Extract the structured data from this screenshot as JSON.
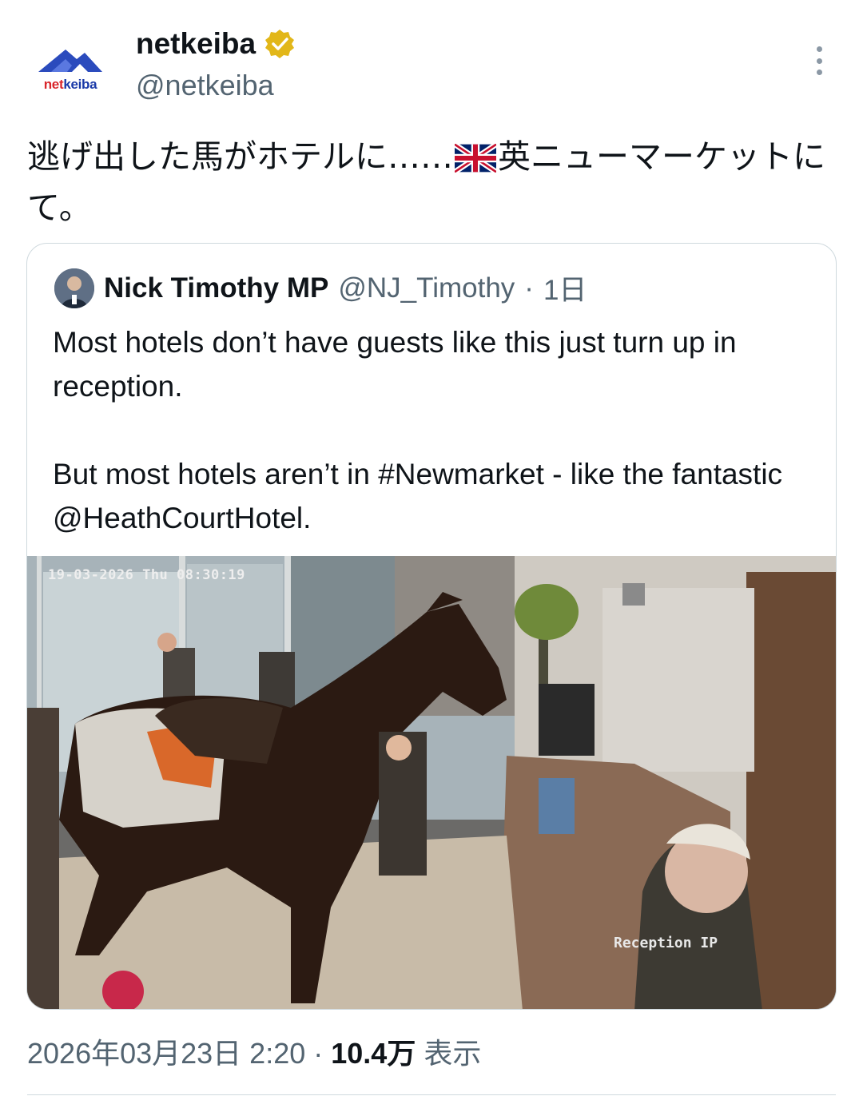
{
  "post": {
    "author": {
      "display_name": "netkeiba",
      "handle": "@netkeiba",
      "verified": true,
      "verified_color": "#e2b719",
      "avatar_logo_text": "netkeiba"
    },
    "more_icon": "more-vertical-icon",
    "text": "逃げ出した馬がホテルに……",
    "text_flag": "🇬🇧",
    "text_after_flag": "英ニューマーケットにて。",
    "quoted": {
      "display_name": "Nick Timothy MP",
      "handle": "@NJ_Timothy",
      "separator": "·",
      "time": "1日",
      "paragraph1": "Most hotels don’t have guests like this just turn up in reception.",
      "paragraph2": "But most hotels aren’t in #Newmarket - like the fantastic @HeathCourtHotel.",
      "media": {
        "overlay_timestamp": "19-03-2026 Thu 08:30:19",
        "overlay_camera": "Reception IP"
      }
    },
    "meta": {
      "timestamp": "2026年03月23日 2:20",
      "separator": "·",
      "views_count": "10.4万",
      "views_label": "表示"
    }
  }
}
